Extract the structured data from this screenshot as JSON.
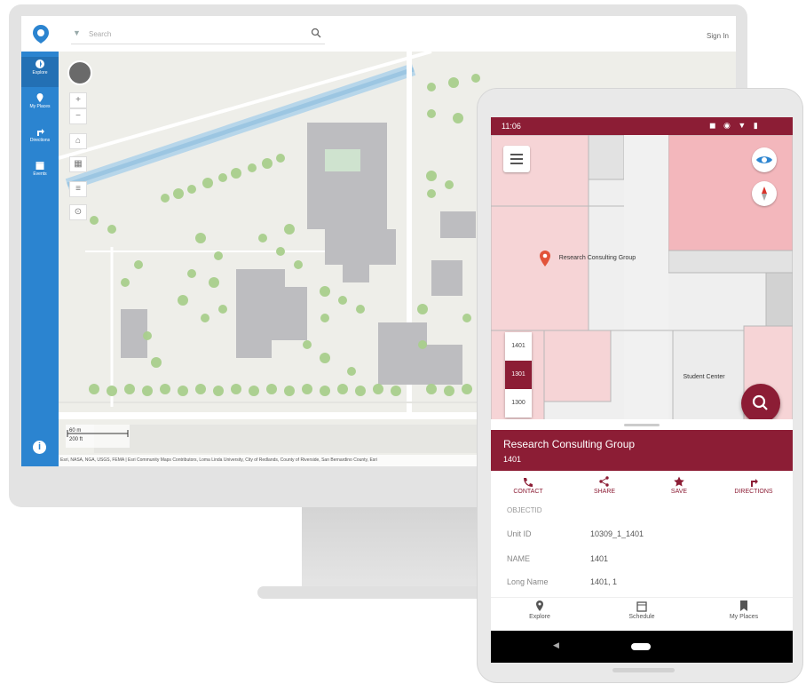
{
  "colors": {
    "brand_blue": "#2b84d0",
    "brand_maroon": "#8c1d35",
    "room_pink": "#f6d4d6"
  },
  "desktop": {
    "search": {
      "placeholder": "Search"
    },
    "signin_label": "Sign In",
    "nav": [
      {
        "label": "Explore",
        "icon": "compass-icon"
      },
      {
        "label": "My Places",
        "icon": "pin-icon"
      },
      {
        "label": "Directions",
        "icon": "directions-icon"
      },
      {
        "label": "Events",
        "icon": "calendar-icon"
      }
    ],
    "map": {
      "scale_top": "60 m",
      "scale_bottom": "200 ft",
      "attribution": "Esri, NASA, NGA, USGS, FEMA | Esri Community Maps Contributors, Loma Linda University, City of Redlands, County of Riverside, San Bernardino County, Esri"
    }
  },
  "phone": {
    "status": {
      "time": "11:06",
      "icons": "◼ ◉ ▼ ▮"
    },
    "floorplan": {
      "selected_place_label": "Research Consulting Group",
      "student_label": "Student Center",
      "floors": [
        "1401",
        "1301",
        "1300"
      ],
      "selected_floor_index": 1
    },
    "sheet": {
      "title": "Research Consulting Group",
      "subtitle": "1401",
      "actions": [
        {
          "label": "CONTACT",
          "icon": "phone-icon"
        },
        {
          "label": "SHARE",
          "icon": "share-icon"
        },
        {
          "label": "SAVE",
          "icon": "star-icon"
        },
        {
          "label": "DIRECTIONS",
          "icon": "directions-icon"
        }
      ],
      "attributes_title": "OBJECTID",
      "attributes": [
        {
          "key": "Unit ID",
          "value": "10309_1_1401"
        },
        {
          "key": "NAME",
          "value": "1401"
        },
        {
          "key": "Long Name",
          "value": "1401, 1"
        }
      ]
    },
    "bottom_nav": [
      {
        "label": "Explore",
        "icon": "pin-icon"
      },
      {
        "label": "Schedule",
        "icon": "calendar-icon"
      },
      {
        "label": "My Places",
        "icon": "bookmark-icon"
      }
    ],
    "system_nav": {
      "back": "◀"
    }
  }
}
